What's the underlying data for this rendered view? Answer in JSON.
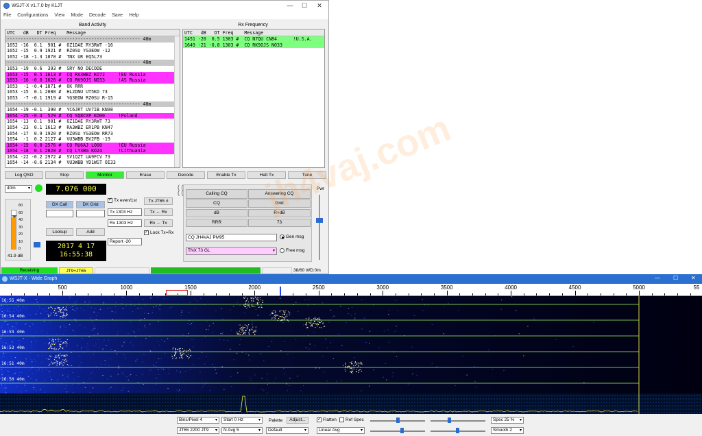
{
  "main_window": {
    "title": "WSJT-X   v1.7.0   by K1JT",
    "menu": [
      "File",
      "Configurations",
      "View",
      "Mode",
      "Decode",
      "Save",
      "Help"
    ],
    "band_activity": {
      "title": "Band Activity",
      "header": "UTC   dB   DT Freq    Message",
      "lines": [
        {
          "text": "------------------------------------------------- 40m",
          "style": "sep"
        },
        {
          "text": "1652 -16  0.1  901 #  OZ1DAE RY3RWT -16",
          "style": ""
        },
        {
          "text": "1652 -15  0.9 1921 #  RZ0SU YG3EOW -12",
          "style": ""
        },
        {
          "text": "1652 -18 -1.3 1870 #  TNX UR EQ5L73",
          "style": ""
        },
        {
          "text": "------------------------------------------------- 40m",
          "style": "sep"
        },
        {
          "text": "1653 -19  0.6  393 #  SRY NO DECODE",
          "style": ""
        },
        {
          "text": "1653 -15  0.5 1613 #  CQ RA3WBZ KO72     !EU Russia",
          "style": "mag"
        },
        {
          "text": "1653 -16 -0.8 1626 #  CQ RK9OJS NO33     !AS Russia",
          "style": "mag"
        },
        {
          "text": "1653  -1 -0.4 1871 #  OK RRR",
          "style": ""
        },
        {
          "text": "1653 -15  0.1 2080 #  HL2DNU UT5KD 73",
          "style": ""
        },
        {
          "text": "1653  -7 -0.1 1919 #  YG3EOW RZ0SU R-15",
          "style": ""
        },
        {
          "text": "------------------------------------------------- 40m",
          "style": "sep"
        },
        {
          "text": "1654 -19 -0.1  390 #  YC6JRT UV7IB KN98",
          "style": ""
        },
        {
          "text": "1654 -25 -0.4  529 #  CQ SQ8CXP KO00     !Poland",
          "style": "mag"
        },
        {
          "text": "1654 -13  0.1  901 #  OZ1DAE RY3RWT 73",
          "style": ""
        },
        {
          "text": "1654 -23  0.1 1613 #  RA3WBZ ER1PB KN47",
          "style": ""
        },
        {
          "text": "1654 -17  0.9 1920 #  RZ0SU YG3EOW RR73",
          "style": ""
        },
        {
          "text": "1654  -1  0.2 2127 #  VU3WBB BV2FB -19",
          "style": ""
        },
        {
          "text": "1654 -15  0.0 2576 #  CQ RU6AJ LO00      !EU Russia",
          "style": "mag"
        },
        {
          "text": "1654 -18  0.1 2820 #  CQ LY3BG KO24      !Lithuania",
          "style": "mag"
        },
        {
          "text": "1654 -22 -0.2 2972 #  SV1QZT UA9FCV 73",
          "style": ""
        },
        {
          "text": "1654 -14 -0.6 2134 #  VU3WBB YD1WST OI33",
          "style": ""
        }
      ]
    },
    "rx_frequency": {
      "title": "Rx Frequency",
      "header": "UTC   dB   DT Freq    Message",
      "lines": [
        {
          "text": "1451 -20  0.5 1303 #  CQ N7QU CN84      !U.S.A.",
          "style": "grn"
        },
        {
          "text": "1649 -21 -0.8 1303 #  CQ RK9OJS NO33",
          "style": "grn"
        }
      ]
    },
    "buttons": [
      "Log QSO",
      "Stop",
      "Monitor",
      "Erase",
      "Decode",
      "Enable Tx",
      "Halt Tx",
      "Tune"
    ],
    "band": "40m",
    "dial_frequency": "7.076 000",
    "dx_call_label": "DX Call",
    "dx_grid_label": "DX Grid",
    "lookup_label": "Lookup",
    "add_label": "Add",
    "date": "2017 4 17",
    "time": "16:55:38",
    "level_db": "41.9 dB",
    "meter_ticks": [
      "80",
      "60",
      "40",
      "30",
      "20",
      "10",
      "0"
    ],
    "tx_even": "Tx even/1st",
    "tx_freq": "Tx  1303  Hz",
    "rx_freq": "Rx  1303  Hz",
    "tx_mode_button": "Tx JT65 #",
    "tx_from_rx": "Tx ← Rx",
    "rx_from_tx": "Rx ← Tx",
    "lock_tx_rx": "Lock Tx=Rx",
    "report": "Report -20",
    "calling_cq": "Calling CQ",
    "answering_cq": "Answering CQ",
    "cq_grid": [
      [
        "CQ",
        "Grid"
      ],
      [
        "dB",
        "R+dB"
      ],
      [
        "RRR",
        "73"
      ]
    ],
    "gen_msg_text": "CQ JH4VAJ PM95",
    "gen_msg_label": "Gen msg",
    "free_msg_text": "TNX 73 GL",
    "free_msg_label": "Free msg",
    "pwr_label": "Pwr",
    "status_receiving": "Receiving",
    "status_mode": "JT9+JT65",
    "status_right": "38/60   WD:0m"
  },
  "wide_graph": {
    "title": "WSJT-X - Wide Graph",
    "freq_labels": [
      "500",
      "1000",
      "1500",
      "2000",
      "2500",
      "3000",
      "3500",
      "4000",
      "4500",
      "5000",
      "55"
    ],
    "rows": [
      {
        "time": "16:55",
        "band": "40m"
      },
      {
        "time": "16:54",
        "band": "40m"
      },
      {
        "time": "16:53",
        "band": "40m"
      },
      {
        "time": "16:52",
        "band": "40m"
      },
      {
        "time": "16:51",
        "band": "40m"
      },
      {
        "time": "16:50",
        "band": "40m"
      }
    ],
    "controls": {
      "bins_per_pixel": "Bins/Pixel  4",
      "start": "Start  0  Hz",
      "palette_label": "Palette",
      "adjust": "Adjust...",
      "flatten": "Flatten",
      "ref_spec": "Ref Spec",
      "spec": "Spec  25  %",
      "mode_sel": "JT65  2200  JT9",
      "n_avg": "N Avg  5",
      "palette": "Default",
      "avg_mode": "Linear Avg",
      "smooth": "Smooth  2"
    }
  },
  "watermark": "jh4vaj.com",
  "colors": {
    "accent": "#2b6fd1",
    "monitor": "#33ee33",
    "highlight_cq": "#ff33ff",
    "rx_line": "#7fff7f",
    "lcd_text": "#ffff55"
  }
}
